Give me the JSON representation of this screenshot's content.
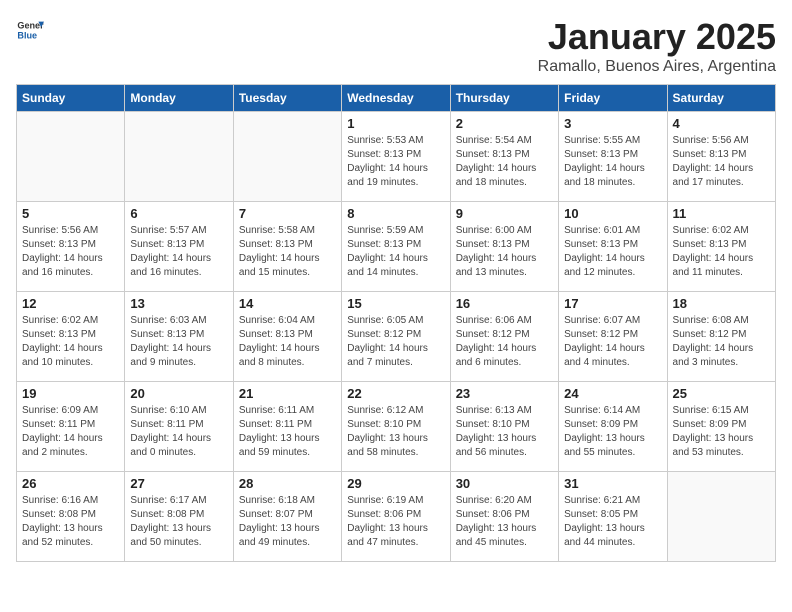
{
  "header": {
    "logo_general": "General",
    "logo_blue": "Blue",
    "title": "January 2025",
    "subtitle": "Ramallo, Buenos Aires, Argentina"
  },
  "days_of_week": [
    "Sunday",
    "Monday",
    "Tuesday",
    "Wednesday",
    "Thursday",
    "Friday",
    "Saturday"
  ],
  "weeks": [
    [
      {
        "day": "",
        "info": ""
      },
      {
        "day": "",
        "info": ""
      },
      {
        "day": "",
        "info": ""
      },
      {
        "day": "1",
        "info": "Sunrise: 5:53 AM\nSunset: 8:13 PM\nDaylight: 14 hours\nand 19 minutes."
      },
      {
        "day": "2",
        "info": "Sunrise: 5:54 AM\nSunset: 8:13 PM\nDaylight: 14 hours\nand 18 minutes."
      },
      {
        "day": "3",
        "info": "Sunrise: 5:55 AM\nSunset: 8:13 PM\nDaylight: 14 hours\nand 18 minutes."
      },
      {
        "day": "4",
        "info": "Sunrise: 5:56 AM\nSunset: 8:13 PM\nDaylight: 14 hours\nand 17 minutes."
      }
    ],
    [
      {
        "day": "5",
        "info": "Sunrise: 5:56 AM\nSunset: 8:13 PM\nDaylight: 14 hours\nand 16 minutes."
      },
      {
        "day": "6",
        "info": "Sunrise: 5:57 AM\nSunset: 8:13 PM\nDaylight: 14 hours\nand 16 minutes."
      },
      {
        "day": "7",
        "info": "Sunrise: 5:58 AM\nSunset: 8:13 PM\nDaylight: 14 hours\nand 15 minutes."
      },
      {
        "day": "8",
        "info": "Sunrise: 5:59 AM\nSunset: 8:13 PM\nDaylight: 14 hours\nand 14 minutes."
      },
      {
        "day": "9",
        "info": "Sunrise: 6:00 AM\nSunset: 8:13 PM\nDaylight: 14 hours\nand 13 minutes."
      },
      {
        "day": "10",
        "info": "Sunrise: 6:01 AM\nSunset: 8:13 PM\nDaylight: 14 hours\nand 12 minutes."
      },
      {
        "day": "11",
        "info": "Sunrise: 6:02 AM\nSunset: 8:13 PM\nDaylight: 14 hours\nand 11 minutes."
      }
    ],
    [
      {
        "day": "12",
        "info": "Sunrise: 6:02 AM\nSunset: 8:13 PM\nDaylight: 14 hours\nand 10 minutes."
      },
      {
        "day": "13",
        "info": "Sunrise: 6:03 AM\nSunset: 8:13 PM\nDaylight: 14 hours\nand 9 minutes."
      },
      {
        "day": "14",
        "info": "Sunrise: 6:04 AM\nSunset: 8:13 PM\nDaylight: 14 hours\nand 8 minutes."
      },
      {
        "day": "15",
        "info": "Sunrise: 6:05 AM\nSunset: 8:12 PM\nDaylight: 14 hours\nand 7 minutes."
      },
      {
        "day": "16",
        "info": "Sunrise: 6:06 AM\nSunset: 8:12 PM\nDaylight: 14 hours\nand 6 minutes."
      },
      {
        "day": "17",
        "info": "Sunrise: 6:07 AM\nSunset: 8:12 PM\nDaylight: 14 hours\nand 4 minutes."
      },
      {
        "day": "18",
        "info": "Sunrise: 6:08 AM\nSunset: 8:12 PM\nDaylight: 14 hours\nand 3 minutes."
      }
    ],
    [
      {
        "day": "19",
        "info": "Sunrise: 6:09 AM\nSunset: 8:11 PM\nDaylight: 14 hours\nand 2 minutes."
      },
      {
        "day": "20",
        "info": "Sunrise: 6:10 AM\nSunset: 8:11 PM\nDaylight: 14 hours\nand 0 minutes."
      },
      {
        "day": "21",
        "info": "Sunrise: 6:11 AM\nSunset: 8:11 PM\nDaylight: 13 hours\nand 59 minutes."
      },
      {
        "day": "22",
        "info": "Sunrise: 6:12 AM\nSunset: 8:10 PM\nDaylight: 13 hours\nand 58 minutes."
      },
      {
        "day": "23",
        "info": "Sunrise: 6:13 AM\nSunset: 8:10 PM\nDaylight: 13 hours\nand 56 minutes."
      },
      {
        "day": "24",
        "info": "Sunrise: 6:14 AM\nSunset: 8:09 PM\nDaylight: 13 hours\nand 55 minutes."
      },
      {
        "day": "25",
        "info": "Sunrise: 6:15 AM\nSunset: 8:09 PM\nDaylight: 13 hours\nand 53 minutes."
      }
    ],
    [
      {
        "day": "26",
        "info": "Sunrise: 6:16 AM\nSunset: 8:08 PM\nDaylight: 13 hours\nand 52 minutes."
      },
      {
        "day": "27",
        "info": "Sunrise: 6:17 AM\nSunset: 8:08 PM\nDaylight: 13 hours\nand 50 minutes."
      },
      {
        "day": "28",
        "info": "Sunrise: 6:18 AM\nSunset: 8:07 PM\nDaylight: 13 hours\nand 49 minutes."
      },
      {
        "day": "29",
        "info": "Sunrise: 6:19 AM\nSunset: 8:06 PM\nDaylight: 13 hours\nand 47 minutes."
      },
      {
        "day": "30",
        "info": "Sunrise: 6:20 AM\nSunset: 8:06 PM\nDaylight: 13 hours\nand 45 minutes."
      },
      {
        "day": "31",
        "info": "Sunrise: 6:21 AM\nSunset: 8:05 PM\nDaylight: 13 hours\nand 44 minutes."
      },
      {
        "day": "",
        "info": ""
      }
    ]
  ]
}
